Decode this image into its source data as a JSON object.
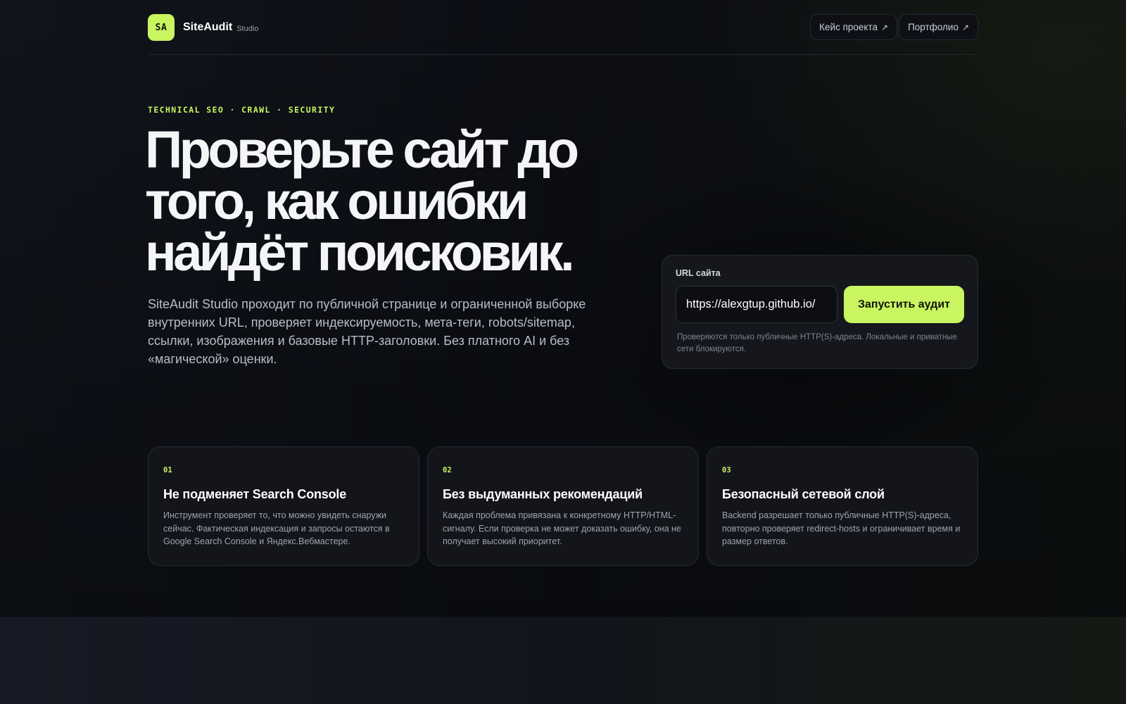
{
  "header": {
    "logo_text": "SA",
    "brand_name": "SiteAudit",
    "brand_sub": "Studio",
    "nav": [
      {
        "label": "Кейс проекта",
        "icon": "arrow-up-right-icon"
      },
      {
        "label": "Портфолио",
        "icon": "arrow-up-right-icon"
      }
    ]
  },
  "hero": {
    "eyebrow": "TECHNICAL SEO · CRAWL · SECURITY",
    "headline": "Проверьте сайт до того, как ошибки найдёт поисковик.",
    "lead": "SiteAudit Studio проходит по публичной странице и ограниченной выборке внутренних URL, проверяет индексируемость, мета-теги, robots/sitemap, ссылки, изображения и базовые HTTP-заголовки. Без платного AI и без «магической» оценки."
  },
  "audit": {
    "label": "URL сайта",
    "url_value": "https://alexgtup.github.io/",
    "button_label": "Запустить аудит",
    "hint": "Проверяются только публичные HTTP(S)-адреса. Локальные и приватные сети блокируются."
  },
  "features": [
    {
      "num": "01",
      "title": "Не подменяет Search Console",
      "text": "Инструмент проверяет то, что можно увидеть снаружи сейчас. Фактическая индексация и запросы остаются в Google Search Console и Яндекс.Вебмастере."
    },
    {
      "num": "02",
      "title": "Без выдуманных рекомендаций",
      "text": "Каждая проблема привязана к конкретному HTTP/HTML-сигналу. Если проверка не может доказать ошибку, она не получает высокий приоритет."
    },
    {
      "num": "03",
      "title": "Безопасный сетевой слой",
      "text": "Backend разрешает только публичные HTTP(S)-адреса, повторно проверяет redirect-hosts и ограничивает время и размер ответов."
    }
  ],
  "colors": {
    "accent": "#c8f560",
    "background": "#0b0d12",
    "card": "#15171d"
  }
}
